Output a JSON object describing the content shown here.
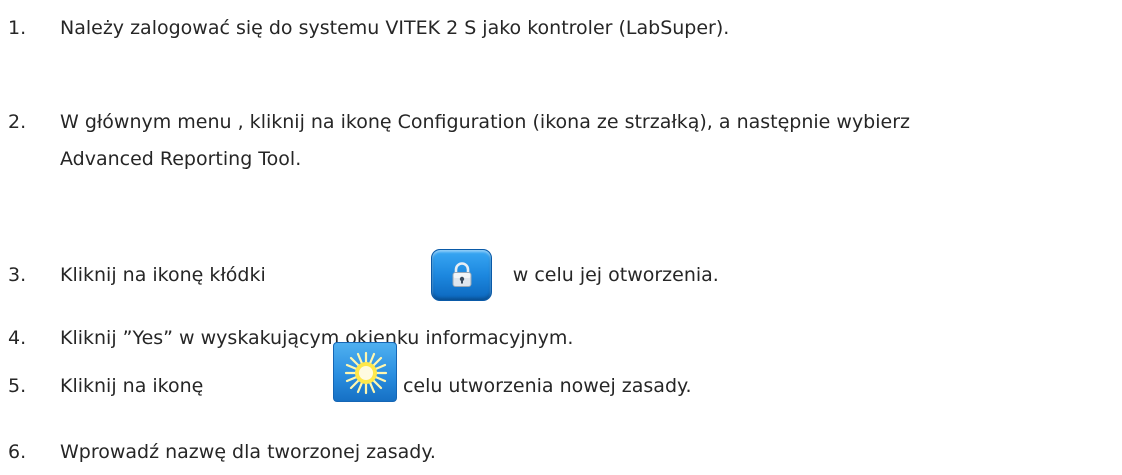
{
  "steps": [
    {
      "number": "1.",
      "text": "Należy zalogować się do systemu VITEK 2 S  jako kontroler (LabSuper)."
    },
    {
      "number": "2.",
      "line1": "W głównym menu , kliknij na ikonę Configuration (ikona ze strzałką), a następnie wybierz",
      "line2": "Advanced Reporting Tool."
    },
    {
      "number": "3.",
      "before": "Kliknij na ikonę kłódki",
      "after": "w celu jej otworzenia.",
      "icon": "lock-icon"
    },
    {
      "number": "4.",
      "text": "Kliknij  ”Yes”  w wyskakującym okienku informacyjnym."
    },
    {
      "number": "5.",
      "before": "Kliknij na ikonę",
      "after": "w celu utworzenia nowej zasady.",
      "icon": "sun-icon"
    },
    {
      "number": "6.",
      "text": "Wprowadź nazwę dla tworzonej zasady."
    }
  ],
  "colors": {
    "text": "#262626",
    "icon_blue": "#1d88df",
    "sun_yellow": "#ffe84a"
  }
}
